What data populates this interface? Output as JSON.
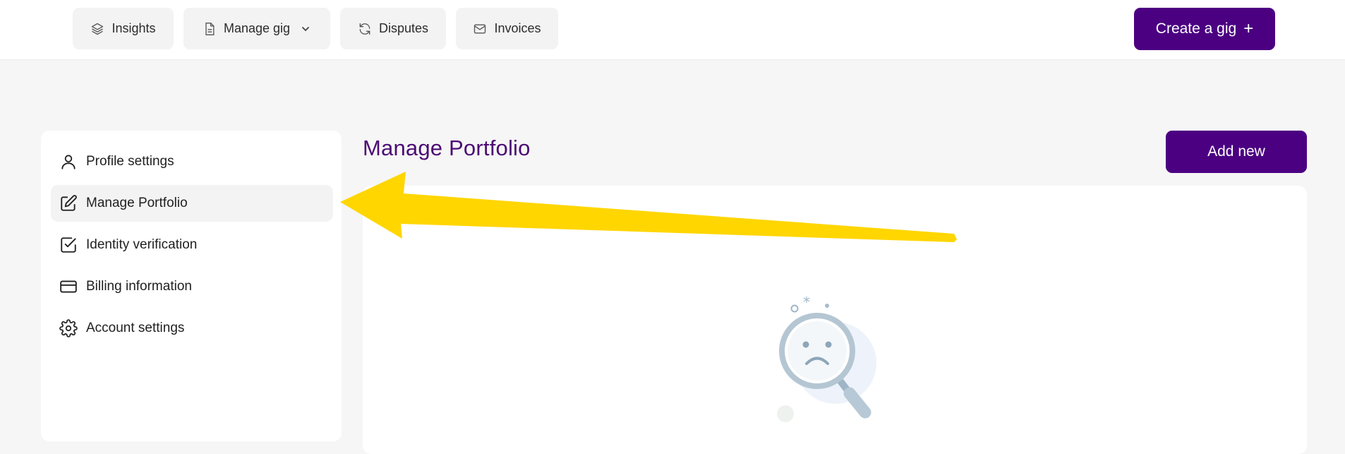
{
  "top_nav": {
    "insights_label": "Insights",
    "manage_gig_label": "Manage gig",
    "disputes_label": "Disputes",
    "invoices_label": "Invoices",
    "create_gig_label": "Create a gig",
    "create_gig_icon": "+"
  },
  "sidebar": {
    "items": [
      {
        "label": "Profile settings",
        "icon": "user-icon"
      },
      {
        "label": "Manage Portfolio",
        "icon": "edit-icon",
        "active": true
      },
      {
        "label": "Identity verification",
        "icon": "checkbox-icon"
      },
      {
        "label": "Billing information",
        "icon": "credit-card-icon"
      },
      {
        "label": "Account settings",
        "icon": "gear-icon"
      }
    ]
  },
  "main": {
    "title": "Manage Portfolio",
    "add_new_label": "Add new",
    "empty_state_icon": "sad-magnifier-icon"
  },
  "colors": {
    "brand": "#4b0082",
    "title": "#4b0b74",
    "annotation_arrow": "#ffd600"
  }
}
